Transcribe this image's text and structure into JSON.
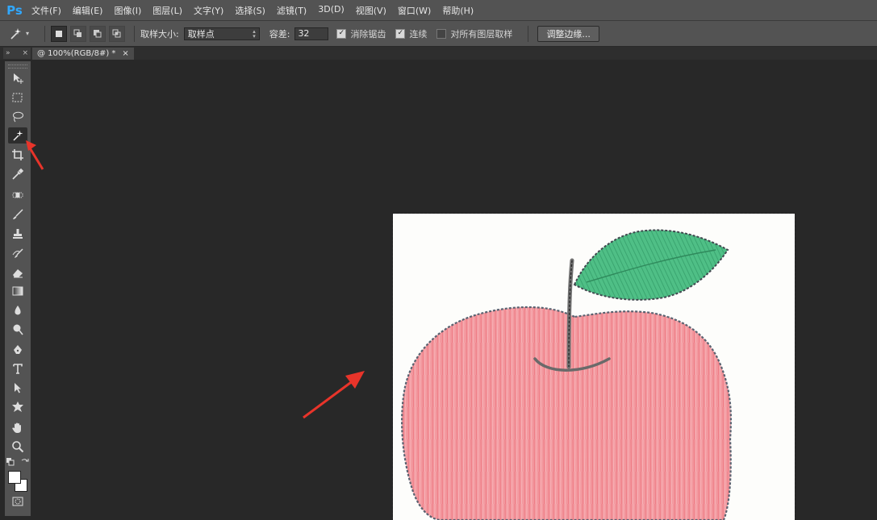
{
  "app": {
    "logo": "Ps"
  },
  "menu": [
    {
      "label": "文件(F)"
    },
    {
      "label": "编辑(E)"
    },
    {
      "label": "图像(I)"
    },
    {
      "label": "图层(L)"
    },
    {
      "label": "文字(Y)"
    },
    {
      "label": "选择(S)"
    },
    {
      "label": "滤镜(T)"
    },
    {
      "label": "3D(D)"
    },
    {
      "label": "视图(V)"
    },
    {
      "label": "窗口(W)"
    },
    {
      "label": "帮助(H)"
    }
  ],
  "options": {
    "sample_size_label": "取样大小:",
    "sample_size_value": "取样点",
    "tolerance_label": "容差:",
    "tolerance_value": "32",
    "anti_alias_label": "消除锯齿",
    "anti_alias_checked": true,
    "contiguous_label": "连续",
    "contiguous_checked": true,
    "sample_all_layers_label": "对所有图层取样",
    "sample_all_layers_checked": false,
    "refine_edge_label": "调整边缘..."
  },
  "document_tab": {
    "title": "@ 100%(RGB/8#) *",
    "close": "×"
  },
  "tools": [
    {
      "name": "move-tool-icon"
    },
    {
      "name": "rect-marquee-tool-icon"
    },
    {
      "name": "lasso-tool-icon"
    },
    {
      "name": "magic-wand-tool-icon",
      "active": true
    },
    {
      "name": "crop-tool-icon"
    },
    {
      "name": "eyedropper-tool-icon"
    },
    {
      "name": "healing-brush-tool-icon"
    },
    {
      "name": "brush-tool-icon"
    },
    {
      "name": "clone-stamp-tool-icon"
    },
    {
      "name": "history-brush-tool-icon"
    },
    {
      "name": "eraser-tool-icon"
    },
    {
      "name": "gradient-tool-icon"
    },
    {
      "name": "blur-tool-icon"
    },
    {
      "name": "dodge-tool-icon"
    },
    {
      "name": "pen-tool-icon"
    },
    {
      "name": "type-tool-icon"
    },
    {
      "name": "path-selection-tool-icon"
    },
    {
      "name": "shape-tool-icon"
    },
    {
      "name": "hand-tool-icon"
    },
    {
      "name": "zoom-tool-icon"
    }
  ],
  "colors": {
    "accent_arrow": "#e8342a",
    "foreground": "#ffffff",
    "background": "#ffffff"
  }
}
